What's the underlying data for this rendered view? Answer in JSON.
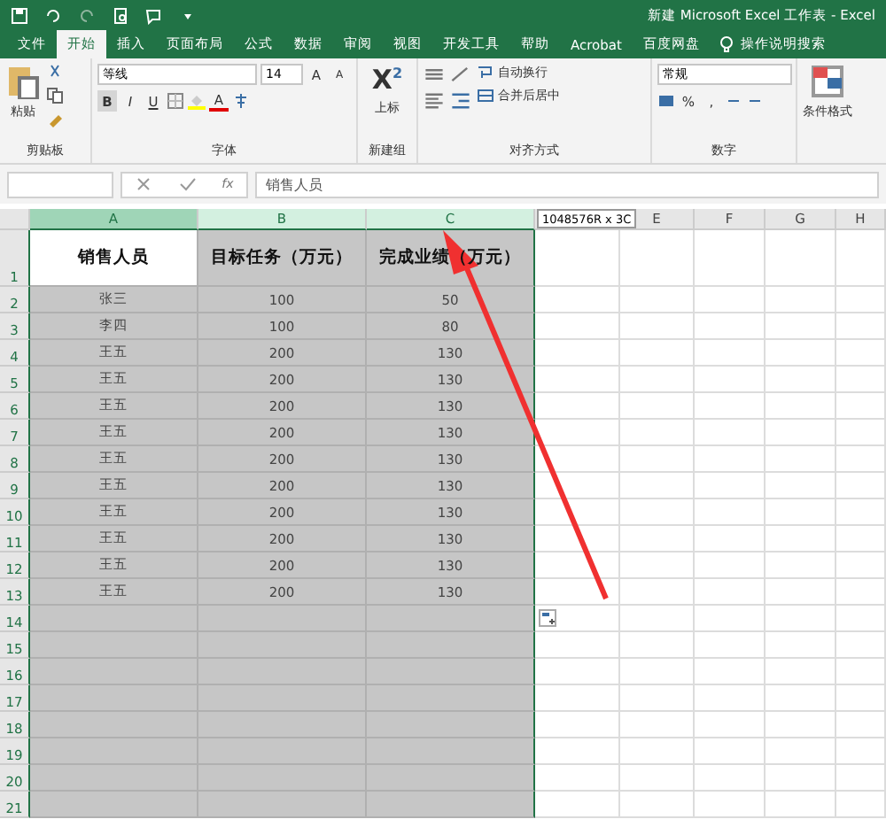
{
  "window": {
    "title": "新建 Microsoft Excel 工作表  -  Excel"
  },
  "menu_tabs": [
    {
      "label": "文件",
      "selected": false
    },
    {
      "label": "开始",
      "selected": true
    },
    {
      "label": "插入",
      "selected": false
    },
    {
      "label": "页面布局",
      "selected": false
    },
    {
      "label": "公式",
      "selected": false
    },
    {
      "label": "数据",
      "selected": false
    },
    {
      "label": "审阅",
      "selected": false
    },
    {
      "label": "视图",
      "selected": false
    },
    {
      "label": "开发工具",
      "selected": false
    },
    {
      "label": "帮助",
      "selected": false
    },
    {
      "label": "Acrobat",
      "selected": false
    },
    {
      "label": "百度网盘",
      "selected": false
    }
  ],
  "tell_me": {
    "placeholder": "操作说明搜索"
  },
  "ribbon": {
    "clipboard": {
      "paste": "粘贴",
      "label": "剪贴板"
    },
    "font": {
      "font_name": "等线",
      "font_size": "14",
      "grow": "A",
      "shrink": "A",
      "bold": "B",
      "italic": "I",
      "underline": "U",
      "font_color": "A",
      "label": "字体"
    },
    "new_group": {
      "glyph": "X",
      "exponent": "2",
      "superscript": "上标",
      "label": "新建组"
    },
    "alignment": {
      "wrap_text": "自动换行",
      "merge": "合并后居中",
      "label": "对齐方式"
    },
    "number": {
      "format": "常规",
      "percent": "%",
      "comma": ",",
      "label": "数字"
    },
    "styles": {
      "conditional": "条件格式"
    }
  },
  "formula_bar": {
    "fx": "fx",
    "content": "销售人员"
  },
  "sheet": {
    "columns": [
      {
        "label": "A",
        "selected": true
      },
      {
        "label": "B",
        "selected": true
      },
      {
        "label": "C",
        "selected": true
      },
      {
        "label": "E",
        "selected": false
      },
      {
        "label": "F",
        "selected": false
      },
      {
        "label": "G",
        "selected": false
      },
      {
        "label": "H",
        "selected": false
      }
    ],
    "size_tooltip": "1048576R x 3C",
    "rows": [
      {
        "number": "1",
        "cells": [
          "销售人员",
          "目标任务（万元）",
          "完成业绩（万元）"
        ]
      },
      {
        "number": "2",
        "cells": [
          "张三",
          "100",
          "50"
        ]
      },
      {
        "number": "3",
        "cells": [
          "李四",
          "100",
          "80"
        ]
      },
      {
        "number": "4",
        "cells": [
          "王五",
          "200",
          "130"
        ]
      },
      {
        "number": "5",
        "cells": [
          "王五",
          "200",
          "130"
        ]
      },
      {
        "number": "6",
        "cells": [
          "王五",
          "200",
          "130"
        ]
      },
      {
        "number": "7",
        "cells": [
          "王五",
          "200",
          "130"
        ]
      },
      {
        "number": "8",
        "cells": [
          "王五",
          "200",
          "130"
        ]
      },
      {
        "number": "9",
        "cells": [
          "王五",
          "200",
          "130"
        ]
      },
      {
        "number": "10",
        "cells": [
          "王五",
          "200",
          "130"
        ]
      },
      {
        "number": "11",
        "cells": [
          "王五",
          "200",
          "130"
        ]
      },
      {
        "number": "12",
        "cells": [
          "王五",
          "200",
          "130"
        ]
      },
      {
        "number": "13",
        "cells": [
          "王五",
          "200",
          "130"
        ]
      },
      {
        "number": "14",
        "cells": []
      },
      {
        "number": "15",
        "cells": []
      },
      {
        "number": "16",
        "cells": []
      },
      {
        "number": "17",
        "cells": []
      },
      {
        "number": "18",
        "cells": []
      },
      {
        "number": "19",
        "cells": []
      },
      {
        "number": "20",
        "cells": []
      },
      {
        "number": "21",
        "cells": []
      }
    ]
  }
}
